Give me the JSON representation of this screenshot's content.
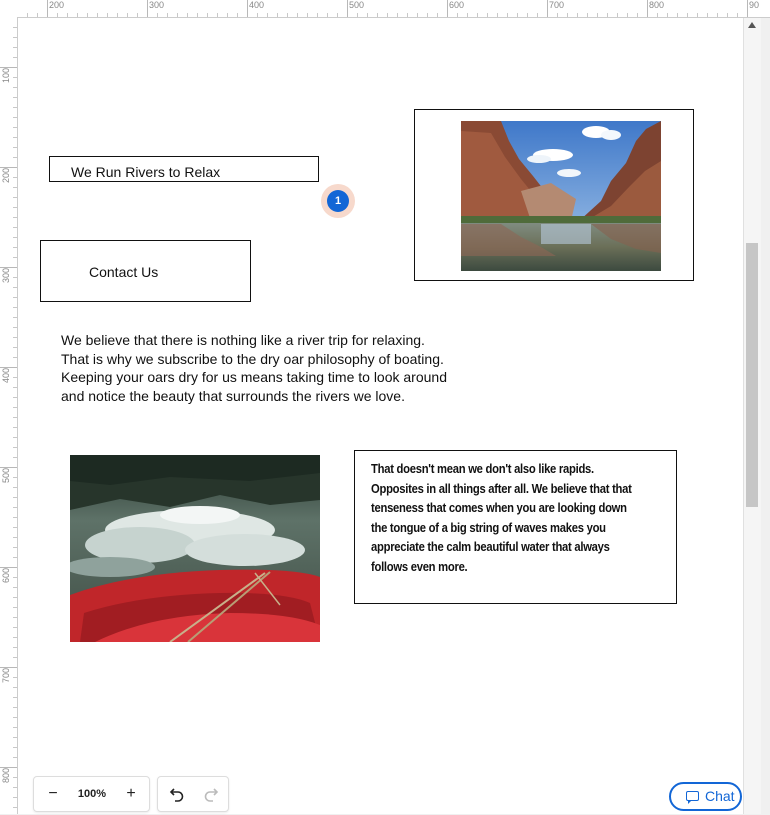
{
  "ruler": {
    "top_labels": [
      "200",
      "300",
      "400",
      "500",
      "600",
      "700",
      "800",
      "90"
    ],
    "left_labels": [
      "100",
      "200",
      "300",
      "400",
      "500",
      "600",
      "700",
      "800"
    ]
  },
  "canvas": {
    "title_text": "We Run Rivers to Relax",
    "contact_text": "Contact Us",
    "paragraph": [
      "We believe that there is nothing like a river trip for relaxing.",
      "That is why we subscribe to the dry oar philosophy of boating.",
      "Keeping your oars dry for us means taking time to look around",
      "and notice the beauty that surrounds the rivers we love."
    ],
    "quote": [
      "That doesn't mean we don't also like rapids.",
      "Opposites in all things after all. We believe that that",
      "tenseness that comes when you are looking down",
      "the tongue of a big string of waves makes you",
      "appreciate the calm beautiful water that always",
      "follows even more."
    ],
    "badge": "1"
  },
  "toolbar": {
    "zoom_out": "−",
    "zoom_level": "100%",
    "zoom_in": "+",
    "undo_icon": "undo-icon",
    "redo_icon": "redo-icon"
  },
  "chat": {
    "label": "Chat",
    "icon": "chat-icon"
  },
  "colors": {
    "accent": "#1266d6",
    "badge_halo": "#f7d9cc",
    "border": "#111111"
  }
}
